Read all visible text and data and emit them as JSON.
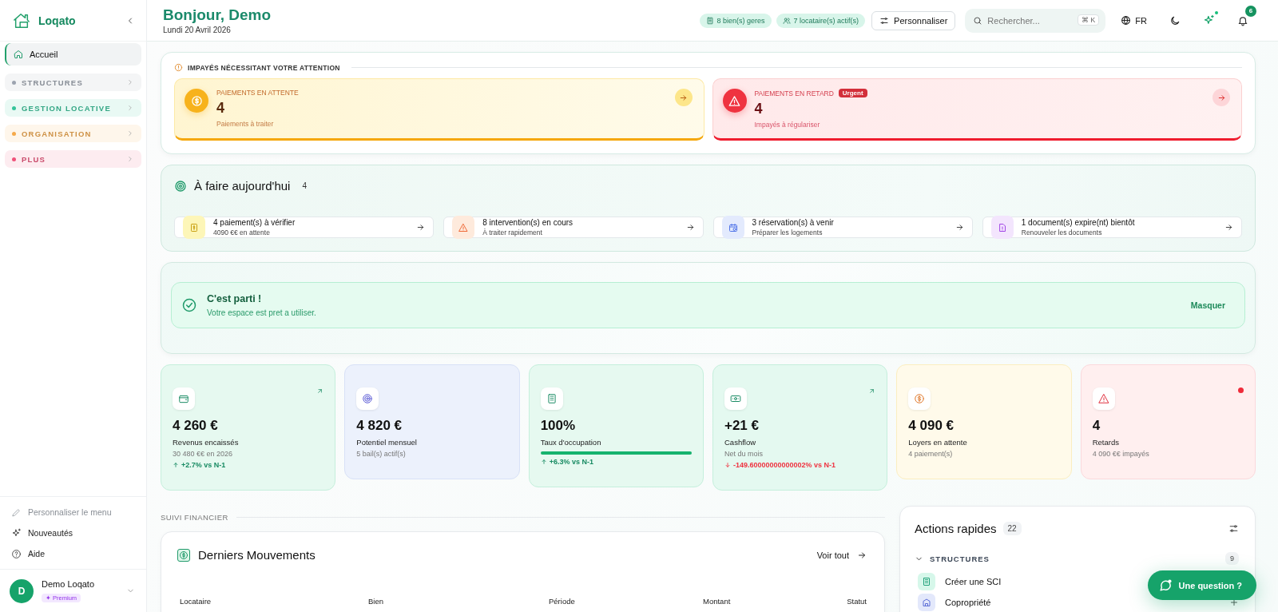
{
  "sidebar": {
    "brand": "Loqato",
    "nav": [
      {
        "kind": "link",
        "label": "Accueil",
        "selected": true
      },
      {
        "kind": "group",
        "label": "STRUCTURES",
        "color": "#9ca3af",
        "selected": false
      },
      {
        "kind": "group",
        "label": "GESTION LOCATIVE",
        "color": "#34c49a",
        "selected": false
      },
      {
        "kind": "group",
        "label": "ORGANISATION",
        "color": "#f5a94a",
        "selected": false
      },
      {
        "kind": "group",
        "label": "PLUS",
        "color": "#f0527a",
        "selected": false
      }
    ],
    "footer_links": [
      {
        "label": "Personnaliser le menu",
        "disabled": true
      },
      {
        "label": "Nouveautés",
        "disabled": false
      },
      {
        "label": "Aide",
        "disabled": false
      }
    ],
    "user": {
      "initial": "D",
      "name": "Demo Loqato",
      "plan": "✦ Premium"
    }
  },
  "header": {
    "greeting": "Bonjour, Demo",
    "date": "Lundi 20 Avril 2026",
    "chips": [
      {
        "label": "8 bien(s) geres"
      },
      {
        "label": "7 locataire(s) actif(s)"
      }
    ],
    "customize_button": "Personnaliser",
    "search": {
      "placeholder": "Rechercher...",
      "shortcut": "⌘ K"
    },
    "language": "FR",
    "whats_new_unread": true,
    "notifications": "6"
  },
  "unpaid_alerts": {
    "title": "IMPAYÉS NÉCESSITANT VOTRE ATTENTION",
    "cards": [
      {
        "kind": "pending",
        "title": "PAIEMENTS EN ATTENTE",
        "value": "4",
        "subtitle": "Paiements à traiter"
      },
      {
        "kind": "overdue",
        "title": "PAIEMENTS EN RETARD",
        "badge": "Urgent",
        "value": "4",
        "subtitle": "Impayés à régulariser"
      }
    ]
  },
  "today": {
    "title": "À faire aujourd'hui",
    "count": "4",
    "tasks": [
      {
        "kind": "payment",
        "title": "4 paiement(s) à vérifier",
        "subtitle": "4090 €€ en attente"
      },
      {
        "kind": "intervention",
        "title": "8 intervention(s) en cours",
        "subtitle": "À traiter rapidement"
      },
      {
        "kind": "booking",
        "title": "3 réservation(s) à venir",
        "subtitle": "Préparer les logements"
      },
      {
        "kind": "document",
        "title": "1 document(s) expire(nt) bientôt",
        "subtitle": "Renouveler les documents"
      }
    ]
  },
  "welcome": {
    "title": "C'est parti !",
    "message": "Votre espace est pret a utiliser.",
    "dismiss": "Masquer"
  },
  "stats": [
    {
      "kind": "revenue",
      "value": "4 260 €",
      "label": "Revenus encaissés",
      "detail": "30 480 €€ en 2026",
      "trend": {
        "negative": false,
        "text": "+2.7% vs N-1"
      },
      "link": true,
      "alert": false
    },
    {
      "kind": "potential",
      "value": "4 820 €",
      "label": "Potentiel mensuel",
      "detail": "5 bail(s) actif(s)",
      "link": false,
      "alert": false
    },
    {
      "kind": "occupancy",
      "value": "100%",
      "label": "Taux d'occupation",
      "level": 1,
      "trend": {
        "negative": false,
        "text": "+6.3% vs N-1"
      },
      "link": false,
      "alert": false
    },
    {
      "kind": "cashflow",
      "value": "+21 €",
      "label": "Cashflow",
      "detail": "Net du mois",
      "trend": {
        "negative": true,
        "text": "-149.60000000000002% vs N-1"
      },
      "link": true,
      "alert": false
    },
    {
      "kind": "pending",
      "value": "4 090 €",
      "label": "Loyers en attente",
      "detail": "4 paiement(s)",
      "link": false,
      "alert": false
    },
    {
      "kind": "overdue",
      "value": "4",
      "label": "Retards",
      "detail": "4 090 €€ impayés",
      "link": false,
      "alert": true
    }
  ],
  "financial_section": {
    "label": "SUIVI FINANCIER"
  },
  "movements": {
    "title": "Derniers Mouvements",
    "action": "Voir tout",
    "columns": [
      "Locataire",
      "Bien",
      "Période",
      "Montant",
      "Statut"
    ]
  },
  "quick_actions": {
    "title": "Actions rapides",
    "count": "22",
    "groups": [
      {
        "label": "STRUCTURES",
        "count": "9",
        "expanded": true,
        "items": [
          {
            "kind": "company",
            "label": "Créer une SCI"
          },
          {
            "kind": "condo",
            "label": "Copropriété"
          }
        ]
      }
    ]
  },
  "help_button": {
    "label": "Une question ?"
  }
}
